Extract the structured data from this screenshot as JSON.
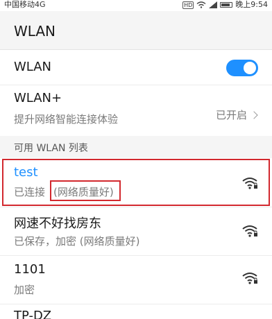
{
  "status_bar": {
    "carrier": "中国移动4G",
    "hd": "HD",
    "time": "晚上9:54"
  },
  "header": {
    "title": "WLAN"
  },
  "wlan_toggle": {
    "label": "WLAN",
    "state": "on",
    "accent": "#1e90ff"
  },
  "wlan_plus": {
    "title": "WLAN+",
    "subtitle": "提升网络智能连接体验",
    "value": "已开启"
  },
  "section": {
    "title": "可用 WLAN 列表"
  },
  "networks": [
    {
      "name": "test",
      "status": "已连接",
      "quality": "(网络质量好)",
      "icon": "wifi-lock-icon"
    },
    {
      "name": "网速不好找房东",
      "status": "已保存，加密 (网络质量好)",
      "icon": "wifi-lock-icon"
    },
    {
      "name": "1101",
      "status": "加密",
      "icon": "wifi-lock-icon"
    },
    {
      "name": "TP-DZ"
    }
  ],
  "colors": {
    "highlight": "#d2282e",
    "active": "#1e90ff"
  }
}
